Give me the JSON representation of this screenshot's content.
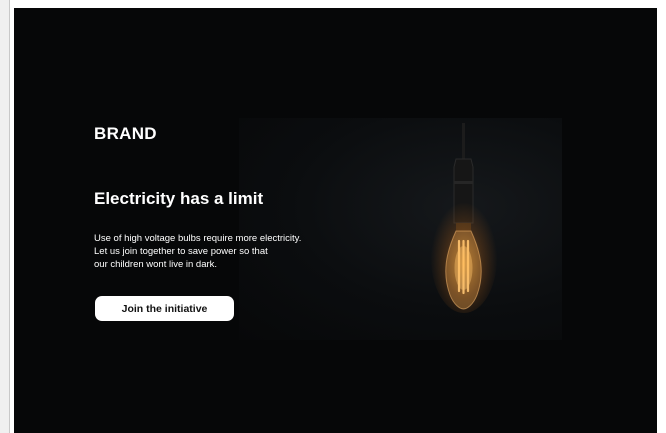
{
  "hero": {
    "brand": "BRAND",
    "headline": "Electricity has a limit",
    "body_lines": [
      "Use of high voltage bulbs require more electricity.",
      "Let us join together to save power so that",
      "our children wont live in dark."
    ],
    "cta_label": "Join the initiative"
  },
  "image": {
    "subject": "bulb-icon"
  },
  "colors": {
    "background": "#060708",
    "text": "#ffffff",
    "button_bg": "#ffffff",
    "button_text": "#111111",
    "bulb_glow": "#ffb04a"
  }
}
